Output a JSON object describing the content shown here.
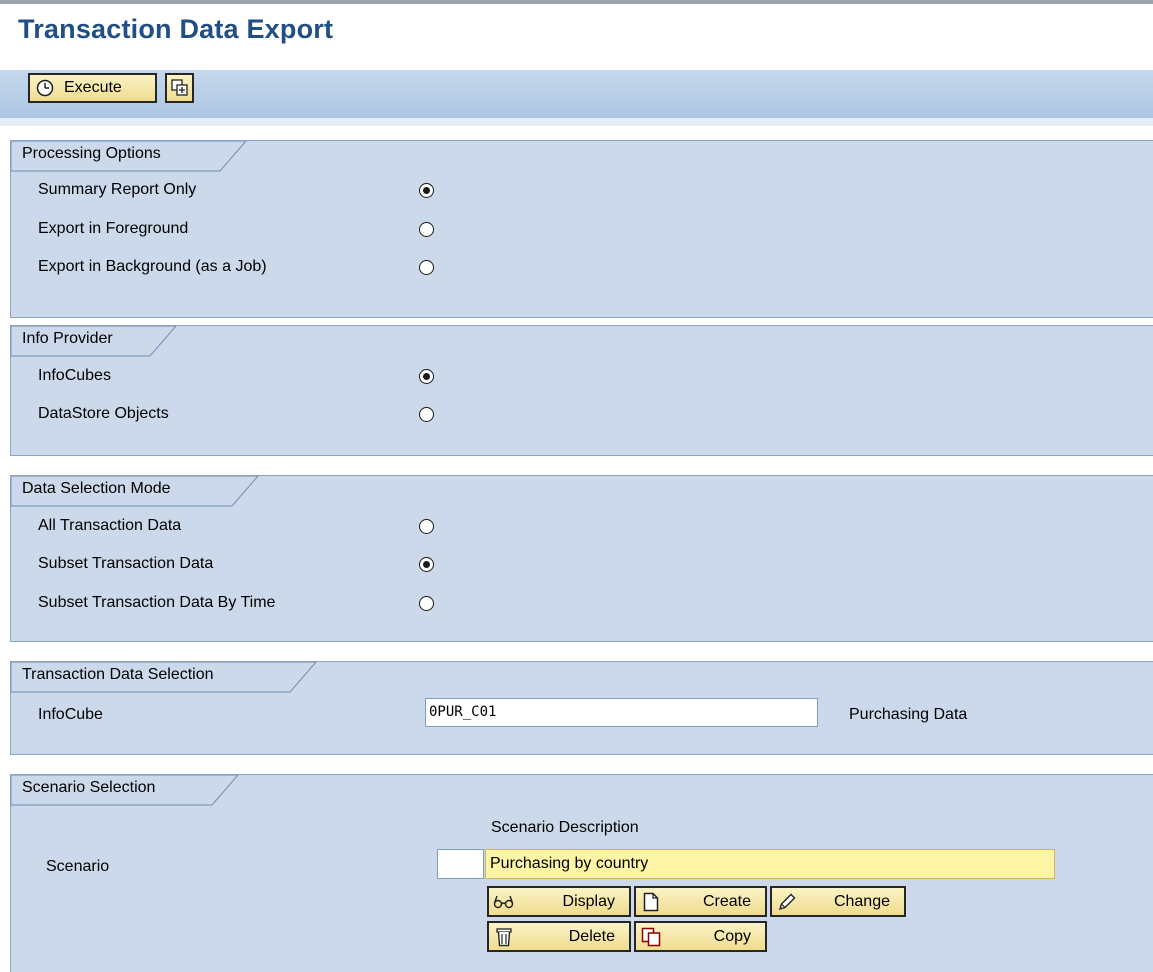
{
  "page": {
    "title": "Transaction Data Export"
  },
  "toolbar": {
    "execute_label": "Execute",
    "execute_icon": "execute-clock-icon",
    "variant_icon": "get-variant-icon"
  },
  "processing_options": {
    "title": "Processing Options",
    "options": [
      {
        "label": "Summary Report Only",
        "selected": true
      },
      {
        "label": "Export in Foreground",
        "selected": false
      },
      {
        "label": "Export in Background (as a Job)",
        "selected": false
      }
    ]
  },
  "info_provider": {
    "title": "Info Provider",
    "options": [
      {
        "label": "InfoCubes",
        "selected": true
      },
      {
        "label": "DataStore Objects",
        "selected": false
      }
    ]
  },
  "data_selection_mode": {
    "title": "Data Selection Mode",
    "options": [
      {
        "label": "All Transaction Data",
        "selected": false
      },
      {
        "label": "Subset Transaction Data",
        "selected": true
      },
      {
        "label": "Subset Transaction Data By Time",
        "selected": false
      }
    ]
  },
  "transaction_data_selection": {
    "title": "Transaction Data Selection",
    "infocube_label": "InfoCube",
    "infocube_value": "0PUR_C01",
    "infocube_description": "Purchasing Data"
  },
  "scenario_selection": {
    "title": "Scenario Selection",
    "description_header": "Scenario Description",
    "scenario_label": "Scenario",
    "scenario_value": "",
    "scenario_description": "Purchasing by country",
    "buttons": {
      "display": "Display",
      "create": "Create",
      "change": "Change",
      "delete": "Delete",
      "copy": "Copy"
    }
  },
  "colors": {
    "title": "#1f4f86",
    "toolbar": "#b6cde6",
    "group_background": "#ccd9ea",
    "button": "#f4e6a6",
    "highlight_field": "#fdf4a5"
  }
}
